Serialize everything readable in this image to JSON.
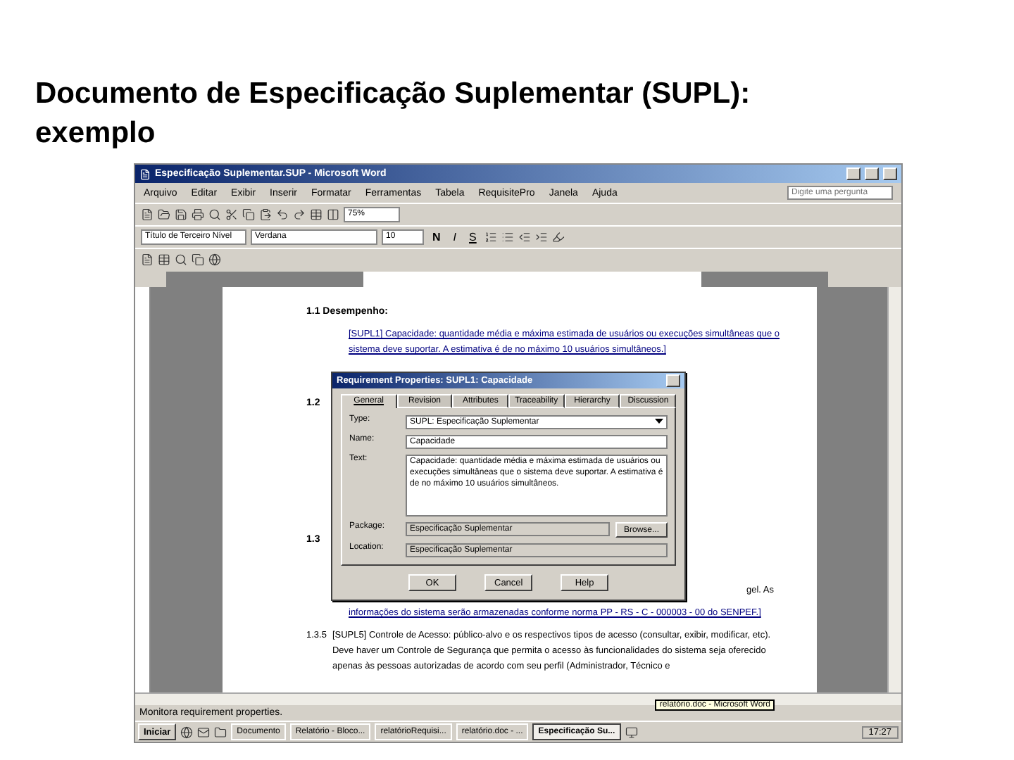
{
  "slide_title": "Documento de Especificação Suplementar (SUPL): exemplo",
  "window": {
    "title": "Especificação Suplementar.SUP - Microsoft Word"
  },
  "menu": [
    "Arquivo",
    "Editar",
    "Exibir",
    "Inserir",
    "Formatar",
    "Ferramentas",
    "Tabela",
    "RequisitePro",
    "Janela",
    "Ajuda"
  ],
  "help_box": {
    "placeholder": "Digite uma pergunta"
  },
  "toolbar": {
    "zoom": "75%",
    "style": "Título de Terceiro Nível",
    "font": "Verdana",
    "size": "10",
    "bold": "N",
    "italic": "I",
    "underline": "S"
  },
  "document": {
    "heading": "1.1 Desempenho:",
    "requirement": "[SUPL1] Capacidade: quantidade média e máxima estimada de usuários ou execuções simultâneas que o sistema deve suportar. A estimativa é de no máximo 10 usuários simultâneos.]",
    "hidden_headings": [
      "1.2",
      "1.3"
    ],
    "continuation_end": "gel. As",
    "continuation": "informações do sistema serão armazenadas conforme norma PP - RS - C - 000003 - 00 do SENPEF.]",
    "item_number": "1.3.5",
    "item_text": "[SUPL5] Controle de Acesso: público-alvo e os respectivos tipos de acesso (consultar, exibir, modificar, etc). Deve haver um Controle de Segurança que permita o acesso às funcionalidades do sistema seja oferecido apenas às pessoas autorizadas de acordo com seu perfil (Administrador, Técnico e"
  },
  "dialog": {
    "title": "Requirement Properties: SUPL1: Capacidade",
    "tabs": [
      {
        "label": "General",
        "selected": true
      },
      {
        "label": "Revision",
        "selected": false
      },
      {
        "label": "Attributes",
        "selected": false
      },
      {
        "label": "Traceability",
        "selected": false
      },
      {
        "label": "Hierarchy",
        "selected": false
      },
      {
        "label": "Discussion",
        "selected": false
      }
    ],
    "fields": [
      {
        "kind": "select",
        "label": "Type:",
        "value": "SUPL: Especificação Suplementar"
      },
      {
        "kind": "input",
        "label": "Name:",
        "value": "Capacidade"
      },
      {
        "kind": "textarea",
        "label": "Text:",
        "value": "Capacidade: quantidade média e máxima estimada de usuários ou execuções simultâneas que o sistema deve suportar. A estimativa é de no máximo 10 usuários simultâneos."
      },
      {
        "kind": "browse",
        "label": "Package:",
        "value": "Especificação Suplementar",
        "button": "Browse..."
      },
      {
        "kind": "readonly",
        "label": "Location:",
        "value": "Especificação Suplementar"
      }
    ],
    "buttons": [
      "OK",
      "Cancel",
      "Help"
    ]
  },
  "status_bar": "Monitora requirement properties.",
  "tooltip": "relatório.doc - Microsoft Word",
  "taskbar": {
    "start": "Iniciar",
    "tasks": [
      {
        "label": "Documento",
        "selected": false
      },
      {
        "label": "Relatório - Bloco...",
        "selected": false
      },
      {
        "label": "relatórioRequisi...",
        "selected": false
      },
      {
        "label": "relatório.doc - ...",
        "selected": false
      },
      {
        "label": "Especificação Su...",
        "selected": true
      }
    ],
    "clock": "17:27"
  }
}
